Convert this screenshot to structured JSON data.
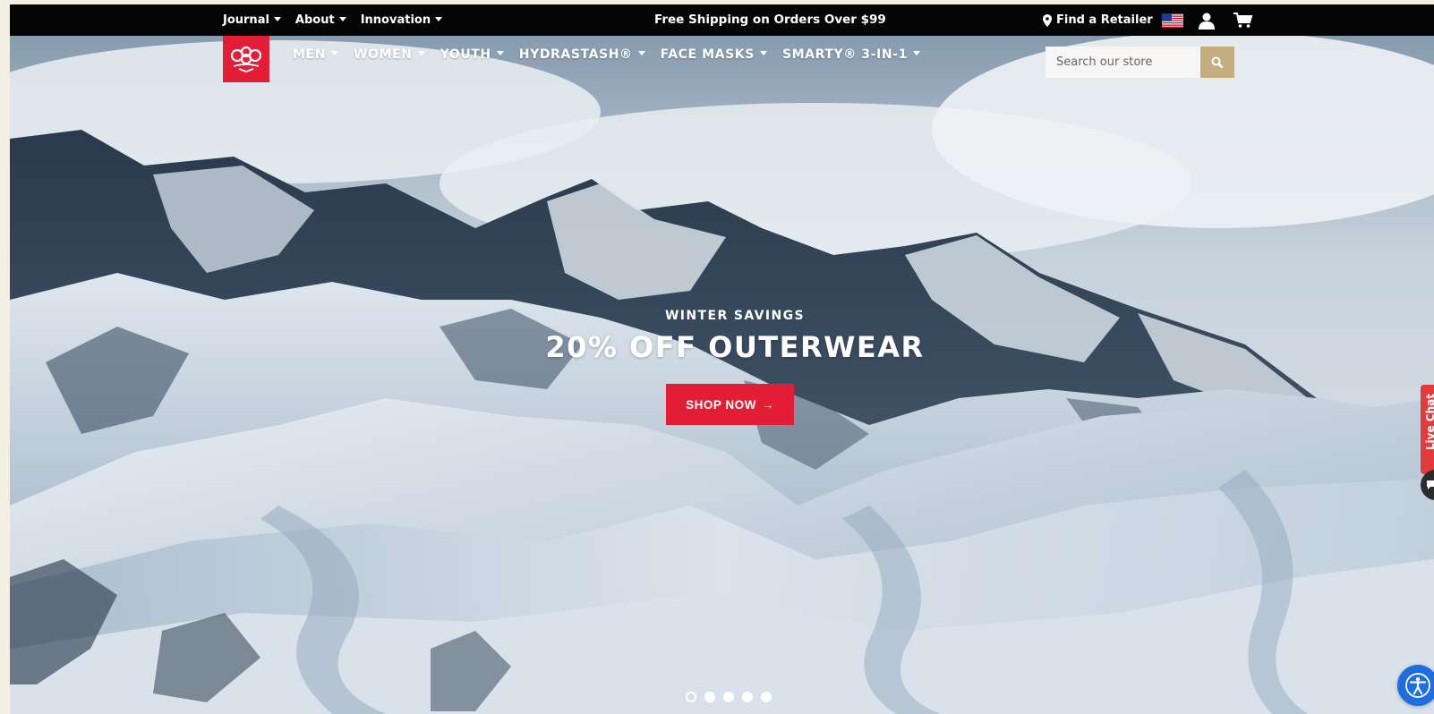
{
  "topbar": {
    "nav": [
      {
        "label": "Journal"
      },
      {
        "label": "About"
      },
      {
        "label": "Innovation"
      }
    ],
    "promo": "Free Shipping on Orders Over $99",
    "retailer_label": "Find a Retailer"
  },
  "logo": {
    "text": "686"
  },
  "mainnav": [
    {
      "label": "MEN"
    },
    {
      "label": "WOMEN"
    },
    {
      "label": "YOUTH"
    },
    {
      "label": "HYDRASTASH®"
    },
    {
      "label": "FACE MASKS"
    },
    {
      "label": "SMARTY® 3-IN-1"
    }
  ],
  "search": {
    "placeholder": "Search our store"
  },
  "hero": {
    "eyebrow": "WINTER SAVINGS",
    "headline": "20% OFF OUTERWEAR",
    "cta_label": "SHOP NOW",
    "cta_arrow": "→"
  },
  "slider": {
    "total": 5,
    "active": 1
  },
  "livechat": {
    "label": "Live Chat"
  },
  "colors": {
    "brand_red": "#e31d35",
    "search_button": "#c4ad80",
    "topbar": "#050505",
    "accessibility": "#1e6ee0"
  },
  "icons": [
    "map-pin-icon",
    "us-flag-icon",
    "user-icon",
    "cart-icon",
    "search-icon",
    "chat-icon",
    "accessibility-icon"
  ]
}
